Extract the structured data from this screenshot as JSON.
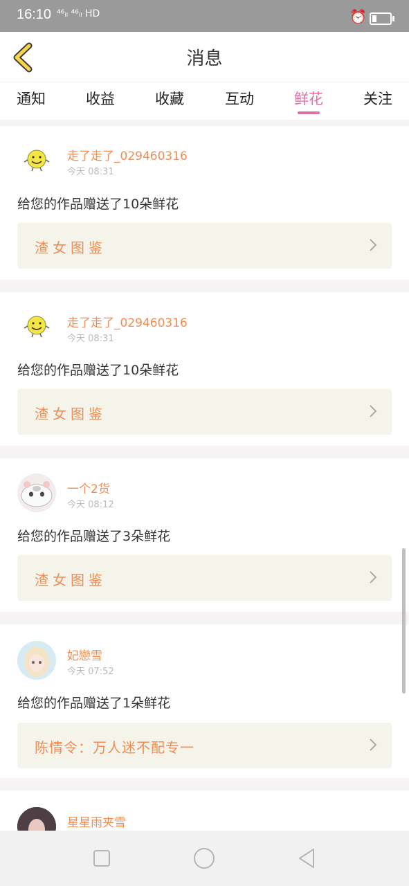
{
  "status": {
    "time": "16:10",
    "network": "⁴⁶ᵢₗ ⁴⁶ᵢₗ HD"
  },
  "header": {
    "title": "消息"
  },
  "tabs": [
    {
      "label": "通知"
    },
    {
      "label": "收益"
    },
    {
      "label": "收藏"
    },
    {
      "label": "互动"
    },
    {
      "label": "鲜花",
      "active": true
    },
    {
      "label": "关注"
    }
  ],
  "messages": [
    {
      "user": "走了走了_029460316",
      "time": "今天 08:31",
      "text": "给您的作品赠送了10朵鲜花",
      "work": "渣女图鉴"
    },
    {
      "user": "走了走了_029460316",
      "time": "今天 08:31",
      "text": "给您的作品赠送了10朵鲜花",
      "work": "渣女图鉴"
    },
    {
      "user": "一个2货",
      "time": "今天 08:12",
      "text": "给您的作品赠送了3朵鲜花",
      "work": "渣女图鉴"
    },
    {
      "user": "妃戀雪",
      "time": "今天 07:52",
      "text": "给您的作品赠送了1朵鲜花",
      "work": "陈情令：万人迷不配专一"
    },
    {
      "user": "星星雨夹雪"
    }
  ],
  "colors": {
    "accent": "#e06fa3",
    "name": "#f08d52",
    "workBg": "#f5f4ea"
  }
}
